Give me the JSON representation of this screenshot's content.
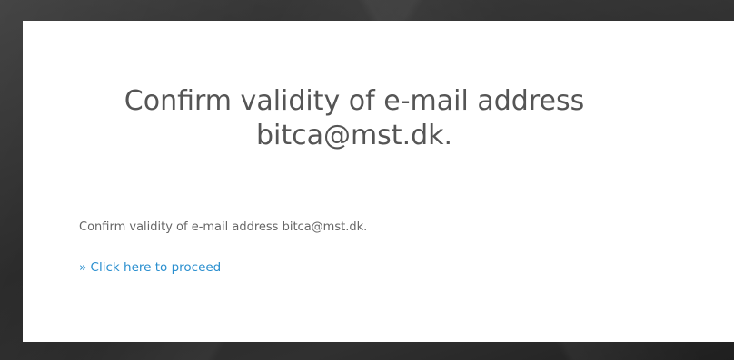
{
  "heading": {
    "line1": "Confirm validity of e-mail address",
    "line2": "bitca@mst.dk."
  },
  "body": {
    "message": "Confirm validity of e-mail address bitca@mst.dk.",
    "proceed_link": "» Click here to proceed"
  },
  "colors": {
    "heading_text": "#555555",
    "body_text": "#666666",
    "link": "#2a8fcf",
    "card_background": "#ffffff",
    "page_background": "#2e2e2e"
  }
}
